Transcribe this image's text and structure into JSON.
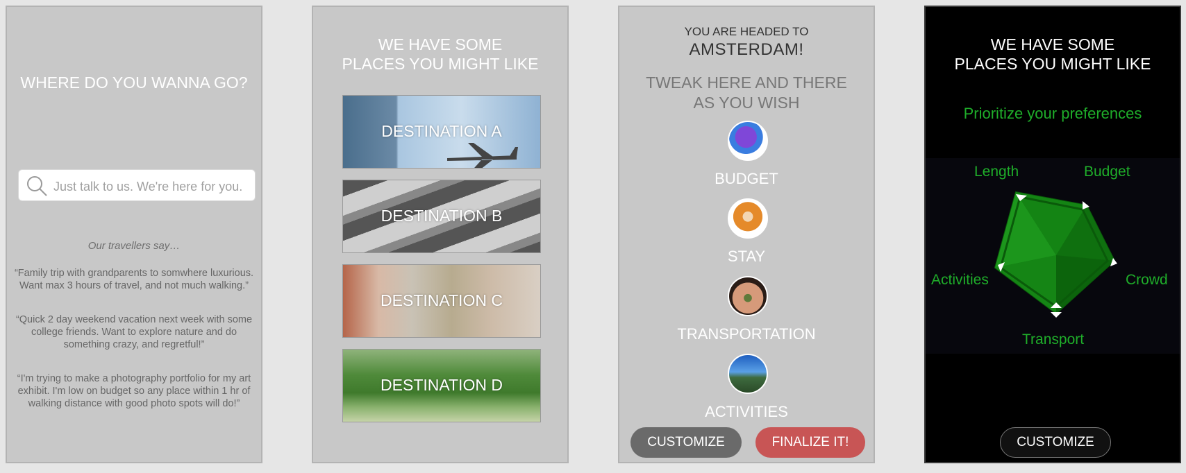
{
  "panel1": {
    "title": "WHERE DO YOU WANNA GO?",
    "search_placeholder": "Just talk to us. We're here for you.",
    "travellers_say": "Our travellers say…",
    "quotes": [
      "“Family trip with grandparents to somwhere luxurious. Want max 3 hours of travel, and not much walking.”",
      "“Quick 2 day weekend vacation next week with some college friends. Want to explore nature and do something crazy, and regretful!”",
      "“I'm trying to make a photography portfolio for my art exhibit. I'm low on budget so any place within 1 hr of walking distance with good photo spots will do!”"
    ]
  },
  "panel2": {
    "title_line1": "WE HAVE SOME",
    "title_line2": "PLACES YOU MIGHT LIKE",
    "destinations": [
      "DESTINATION A",
      "DESTINATION B",
      "DESTINATION C",
      "DESTINATION D"
    ]
  },
  "panel3": {
    "headed": "YOU ARE HEADED TO",
    "city": "AMSTERDAM!",
    "tweak_line1": "TWEAK HERE AND THERE",
    "tweak_line2": "AS YOU WISH",
    "categories": [
      "BUDGET",
      "STAY",
      "TRANSPORTATION",
      "ACTIVITIES"
    ],
    "customize": "CUSTOMIZE",
    "finalize": "FINALIZE IT!"
  },
  "panel4": {
    "title_line1": "WE HAVE SOME",
    "title_line2": "PLACES YOU MIGHT LIKE",
    "prioritize": "Prioritize your preferences",
    "axes": [
      "Length",
      "Budget",
      "Crowd",
      "Transport",
      "Activities"
    ],
    "customize": "CUSTOMIZE"
  },
  "colors": {
    "panel_bg": "#c8c8c8",
    "accent_green": "#1fae2a",
    "finalize_red": "#c85555",
    "customize_gray": "#6a6a6a"
  }
}
